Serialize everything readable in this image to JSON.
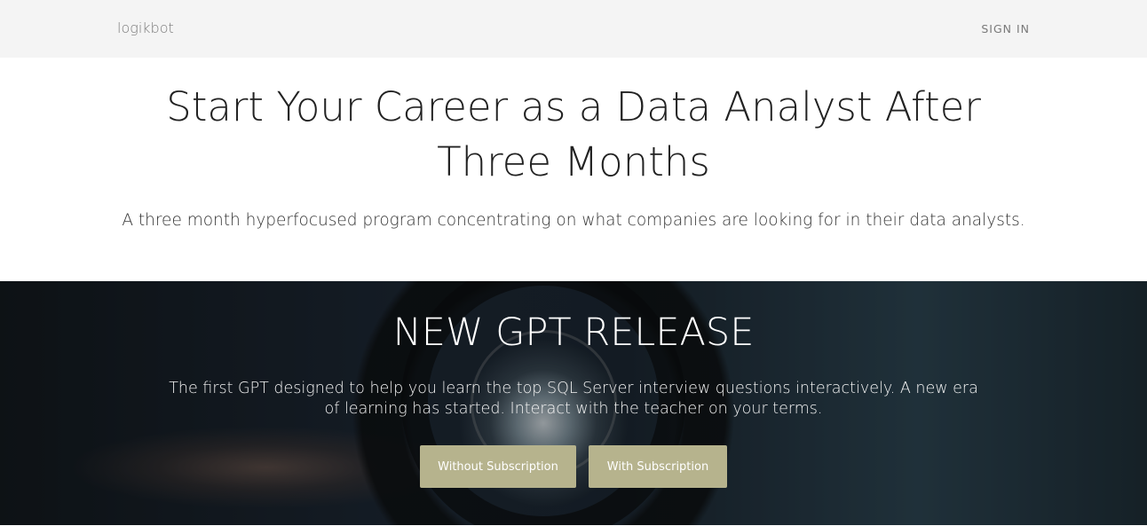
{
  "nav": {
    "brand": "logikbot",
    "sign_in": "SIGN IN"
  },
  "hero": {
    "title": "Start Your Career as a Data Analyst After Three Months",
    "subtitle": "A three month hyperfocused program concentrating on what companies are looking for in their data analysts."
  },
  "banner": {
    "title": "NEW GPT RELEASE",
    "description": "The first GPT designed to help you learn the top SQL Server interview questions interactively. A new era of learning has started. Interact with the teacher on your terms.",
    "buttons": [
      {
        "label": "Without Subscription"
      },
      {
        "label": "With Subscription"
      }
    ]
  },
  "colors": {
    "nav_background": "#f4f4f4",
    "button_background": "#b6b38d",
    "banner_dark": "#13191f"
  }
}
